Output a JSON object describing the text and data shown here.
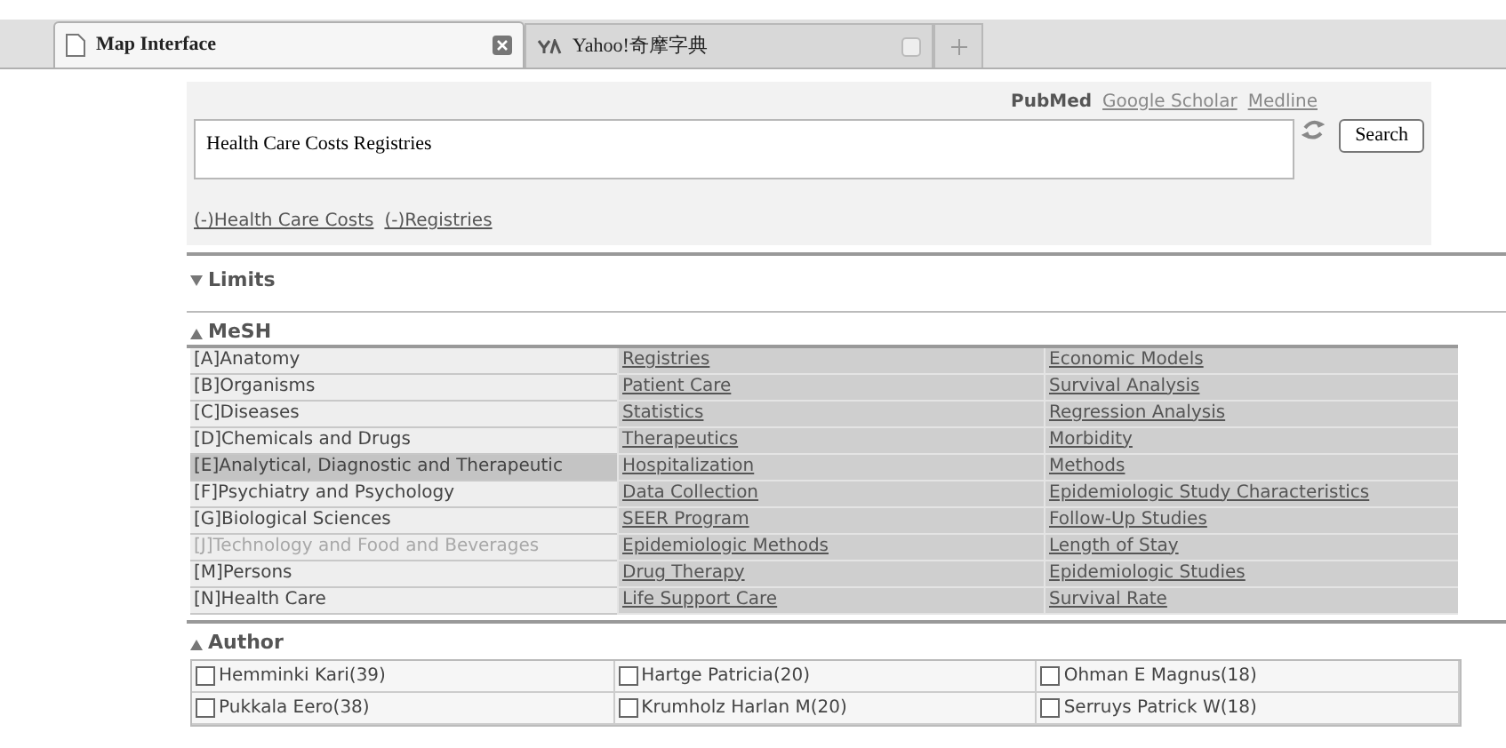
{
  "tabs": [
    {
      "label": "Map Interface",
      "selected": true
    },
    {
      "label": "Yahoo!奇摩字典",
      "selected": false
    }
  ],
  "search": {
    "sources": [
      {
        "label": "PubMed",
        "selected": true
      },
      {
        "label": "Google Scholar",
        "selected": false
      },
      {
        "label": "Medline",
        "selected": false
      }
    ],
    "value": "Health Care Costs Registries",
    "button": "Search",
    "terms": [
      "(-)Health Care Costs",
      "(-)Registries"
    ]
  },
  "limits": {
    "title": "Limits",
    "expanded": false
  },
  "mesh": {
    "title": "MeSH",
    "rows": [
      {
        "category": "[A]Anatomy",
        "highlighted": false,
        "disabled": false,
        "term_1": "Registries",
        "term_2": "Economic Models"
      },
      {
        "category": "[B]Organisms",
        "highlighted": false,
        "disabled": false,
        "term_1": "Patient Care",
        "term_2": "Survival Analysis"
      },
      {
        "category": "[C]Diseases",
        "highlighted": false,
        "disabled": false,
        "term_1": "Statistics",
        "term_2": "Regression Analysis"
      },
      {
        "category": "[D]Chemicals and Drugs",
        "highlighted": false,
        "disabled": false,
        "term_1": "Therapeutics",
        "term_2": "Morbidity"
      },
      {
        "category": "[E]Analytical, Diagnostic and Therapeutic",
        "highlighted": true,
        "disabled": false,
        "term_1": "Hospitalization",
        "term_2": "Methods"
      },
      {
        "category": "[F]Psychiatry and Psychology",
        "highlighted": false,
        "disabled": false,
        "term_1": "Data Collection",
        "term_2": "Epidemiologic Study Characteristics"
      },
      {
        "category": "[G]Biological Sciences",
        "highlighted": false,
        "disabled": false,
        "term_1": "SEER Program",
        "term_2": "Follow-Up Studies"
      },
      {
        "category": "[J]Technology and Food and Beverages",
        "highlighted": false,
        "disabled": true,
        "term_1": "Epidemiologic Methods",
        "term_2": "Length of Stay"
      },
      {
        "category": "[M]Persons",
        "highlighted": false,
        "disabled": false,
        "term_1": "Drug Therapy",
        "term_2": "Epidemiologic Studies"
      },
      {
        "category": "[N]Health Care",
        "highlighted": false,
        "disabled": false,
        "term_1": "Life Support Care",
        "term_2": "Survival Rate"
      }
    ]
  },
  "author": {
    "title": "Author",
    "items": [
      {
        "label": "Hemminki Kari(39)",
        "checked": false
      },
      {
        "label": "Hartge Patricia(20)",
        "checked": false
      },
      {
        "label": "Ohman E Magnus(18)",
        "checked": false
      },
      {
        "label": "Pukkala Eero(38)",
        "checked": false
      },
      {
        "label": "Krumholz Harlan M(20)",
        "checked": false
      },
      {
        "label": "Serruys Patrick W(18)",
        "checked": false
      }
    ]
  }
}
